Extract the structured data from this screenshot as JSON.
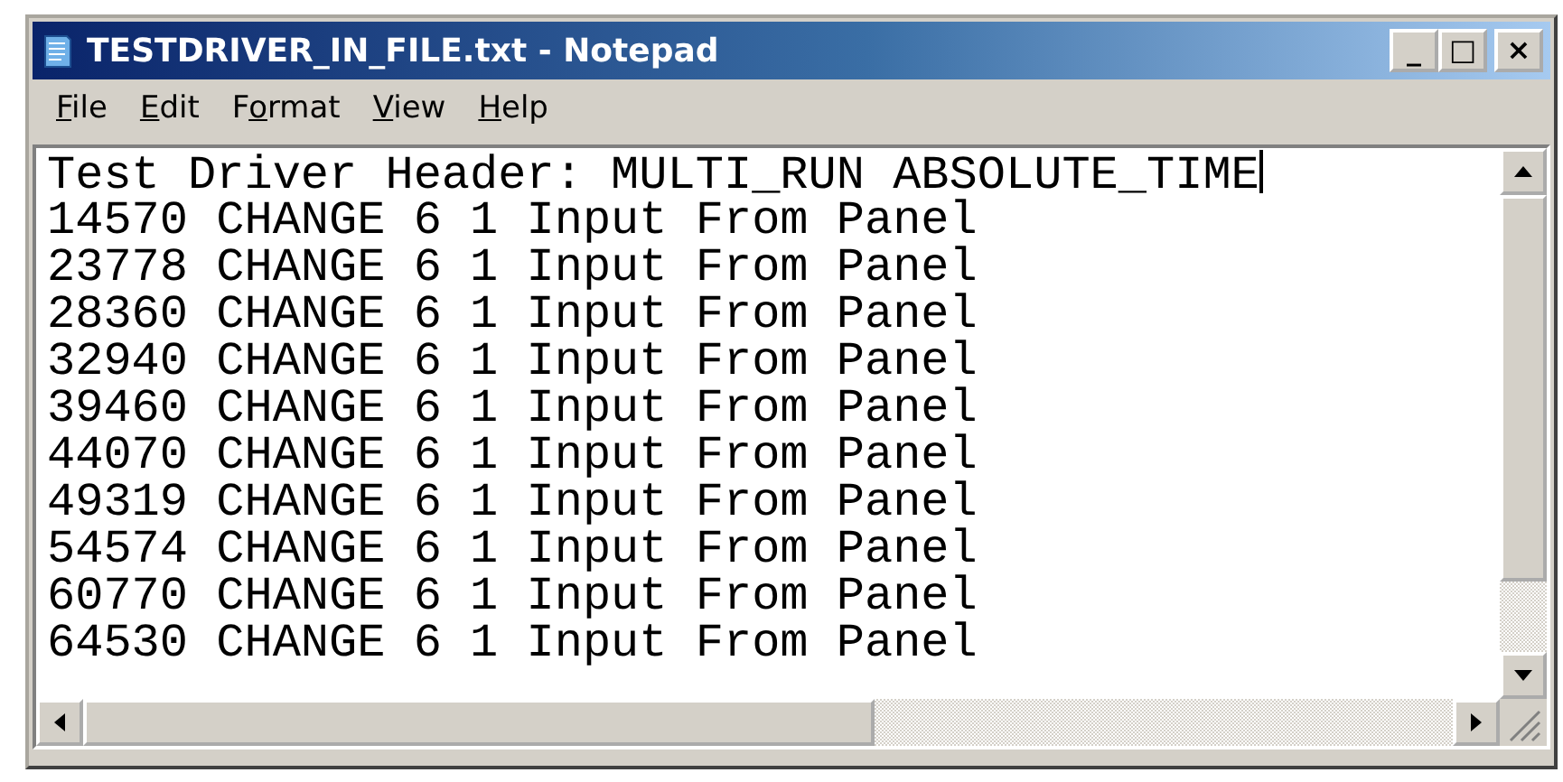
{
  "window": {
    "title": "TESTDRIVER_IN_FILE.txt - Notepad",
    "controls": [
      "_",
      "□",
      "×"
    ]
  },
  "menu": [
    {
      "access_key": "F",
      "rest": "ile"
    },
    {
      "access_key": "E",
      "rest": "dit"
    },
    {
      "lead": "F",
      "access_key": "o",
      "rest": "rmat"
    },
    {
      "access_key": "V",
      "rest": "iew"
    },
    {
      "access_key": "H",
      "rest": "elp"
    }
  ],
  "editor": {
    "lines": [
      {
        "text": "Test Driver Header: MULTI_RUN ABSOLUTE_TIME",
        "caret": true
      },
      {
        "text": "14570 CHANGE 6 1 Input From Panel",
        "caret": false
      },
      {
        "text": "23778 CHANGE 6 1 Input From Panel",
        "caret": false
      },
      {
        "text": "28360 CHANGE 6 1 Input From Panel",
        "caret": false
      },
      {
        "text": "32940 CHANGE 6 1 Input From Panel",
        "caret": false
      },
      {
        "text": "39460 CHANGE 6 1 Input From Panel",
        "caret": false
      },
      {
        "text": "44070 CHANGE 6 1 Input From Panel",
        "caret": false
      },
      {
        "text": "49319 CHANGE 6 1 Input From Panel",
        "caret": false
      },
      {
        "text": "54574 CHANGE 6 1 Input From Panel",
        "caret": false
      },
      {
        "text": "60770 CHANGE 6 1 Input From Panel",
        "caret": false
      },
      {
        "text": "64530 CHANGE 6 1 Input From Panel",
        "caret": false
      }
    ]
  }
}
